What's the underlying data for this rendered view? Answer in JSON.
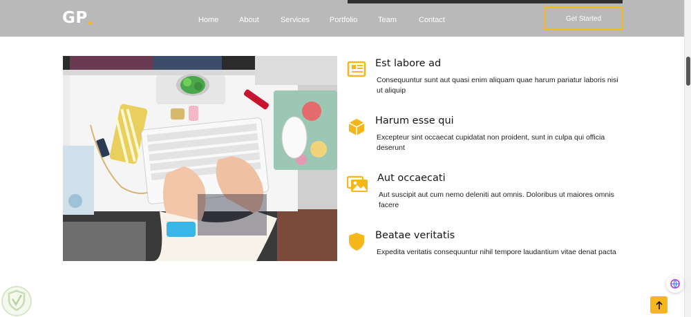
{
  "header": {
    "logo": "GP",
    "nav": [
      "Home",
      "About",
      "Services",
      "Portfolio",
      "Team",
      "Contact"
    ],
    "cta": "Get Started"
  },
  "features": [
    {
      "icon": "newspaper-icon",
      "title": "Est labore ad",
      "desc": "Consequuntur sunt aut quasi enim aliquam quae harum pariatur laboris nisi ut aliquip"
    },
    {
      "icon": "cube-icon",
      "title": "Harum esse qui",
      "desc": "Excepteur sint occaecat cupidatat non proident, sunt in culpa qui officia deserunt"
    },
    {
      "icon": "images-icon",
      "title": "Aut occaecati",
      "desc": "Aut suscipit aut cum nemo deleniti aut omnis. Doloribus ut maiores omnis facere"
    },
    {
      "icon": "shield-icon",
      "title": "Beatae veritatis",
      "desc": "Expedita veritatis consequuntur nihil tempore laudantium vitae denat pacta"
    }
  ],
  "colors": {
    "accent": "#f5b71a",
    "header_bg": "#b9b9b9"
  }
}
